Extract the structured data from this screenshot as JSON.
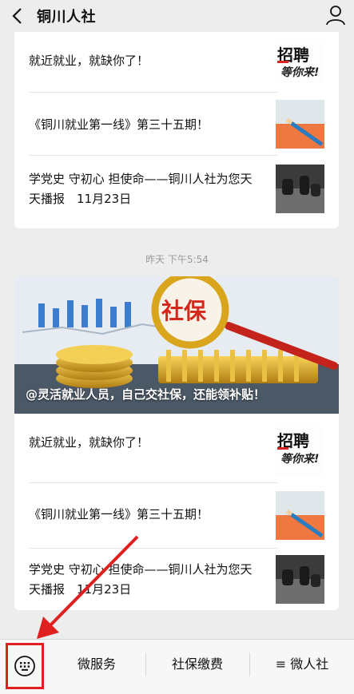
{
  "header": {
    "title": "铜川人社"
  },
  "top_card": {
    "items": [
      {
        "title": "就近就业，就缺你了！"
      },
      {
        "title": "《铜川就业第一线》第三十五期！"
      },
      {
        "title": "学党史 守初心 担使命——铜川人社为您天天播报　11月23日"
      }
    ],
    "thumb_text": "招聘",
    "thumb_text2": "等你来!"
  },
  "timestamp": "昨天 下午5:54",
  "bottom_card": {
    "hero_caption": "@灵活就业人员，自己交社保，还能领补贴！",
    "hero_badge": "社保",
    "items": [
      {
        "title": "就近就业，就缺你了！"
      },
      {
        "title": "《铜川就业第一线》第三十五期！"
      },
      {
        "title": "学党史 守初心 担使命——铜川人社为您天天播报　11月23日"
      }
    ],
    "thumb_text": "招聘",
    "thumb_text2": "等你来!"
  },
  "menu": {
    "items": [
      {
        "label": "微服务"
      },
      {
        "label": "社保缴费"
      },
      {
        "label": "≡ 微人社"
      }
    ]
  },
  "colors": {
    "accent_red": "#e02020",
    "background": "#ededed"
  }
}
